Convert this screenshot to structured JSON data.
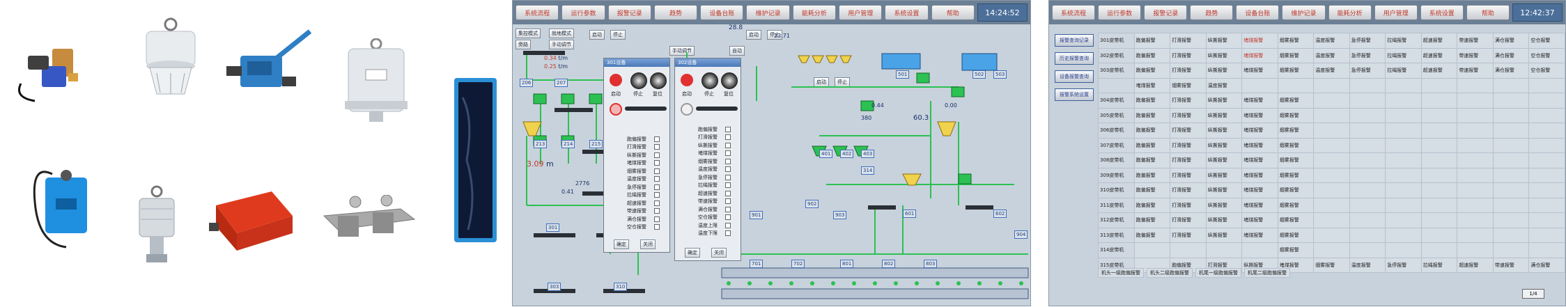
{
  "colors": {
    "scada_bg": "#c8d2dc",
    "tab_text": "#c0392b",
    "pipe_green": "#2cc152",
    "lamp_red": "#e03030",
    "device_blue": "#3a9ad9",
    "device_red": "#d9402a"
  },
  "products": {
    "items": [
      {
        "name": "speed-sensor",
        "icon": "sensor-icon"
      },
      {
        "name": "tear-protector",
        "icon": "bell-sensor-icon"
      },
      {
        "name": "pull-rope-switch",
        "icon": "lever-switch-icon"
      },
      {
        "name": "deviation-switch",
        "icon": "bell-sensor-icon"
      },
      {
        "name": "smoke-sensor-panel",
        "icon": "panel-icon"
      },
      {
        "name": "level-sensor-box",
        "icon": "box-sensor-icon"
      },
      {
        "name": "temperature-sensor",
        "icon": "probe-icon"
      },
      {
        "name": "control-box",
        "icon": "red-box-icon"
      },
      {
        "name": "chute-blocking-switch",
        "icon": "bracket-icon"
      }
    ]
  },
  "scada1": {
    "tabs": [
      "系统流程",
      "运行参数",
      "报警记录",
      "趋势",
      "设备台账",
      "维护记录",
      "能耗分析",
      "用户管理",
      "系统设置",
      "帮助"
    ],
    "clock": "14:24:52",
    "buttons": {
      "mode1": "集控模式",
      "mode2": "就地模式",
      "start": "启动",
      "stop": "停止",
      "manual": "手动调节",
      "auto": "自动",
      "confirm": "确定",
      "close": "关闭",
      "bypass": "旁路"
    },
    "readouts": {
      "flow1": "0.34",
      "flow1_unit": "t/m",
      "flow2": "0.25",
      "flow2_unit": "t/m",
      "level1": "3.09",
      "level1_unit": "m",
      "rate1": "0.41",
      "rate2": "0.44",
      "rate3": "0.00",
      "tank_val": "28.8",
      "tank2_val": "23.71",
      "capacity": "2776",
      "volume": "380",
      "level_pct": "60.3"
    },
    "tags": [
      "206",
      "207",
      "213",
      "214",
      "215",
      "216",
      "301",
      "302",
      "303",
      "310",
      "314",
      "401",
      "402",
      "403",
      "501",
      "502",
      "503",
      "601",
      "602",
      "701",
      "702",
      "801",
      "802",
      "803",
      "901",
      "902",
      "903",
      "904"
    ],
    "dialog1": {
      "title": "301设备",
      "labels": [
        "启动",
        "停止",
        "复位"
      ],
      "alarms": [
        "跑偏报警",
        "打滑报警",
        "纵撕报警",
        "堵煤报警",
        "烟雾报警",
        "温度报警",
        "急停报警",
        "拉绳报警",
        "超速报警",
        "带速报警",
        "满仓报警",
        "空仓报警"
      ],
      "ok": "确定",
      "cancel": "关闭"
    },
    "dialog2": {
      "title": "302设备",
      "labels": [
        "启动",
        "停止",
        "复位"
      ],
      "alarms": [
        "跑偏报警",
        "打滑报警",
        "纵撕报警",
        "堵煤报警",
        "烟雾报警",
        "温度报警",
        "急停报警",
        "拉绳报警",
        "超速报警",
        "带速报警",
        "满仓报警",
        "空仓报警",
        "温度上限",
        "温度下限"
      ],
      "ok": "确定",
      "cancel": "关闭"
    }
  },
  "scada2": {
    "tabs": [
      "系统流程",
      "运行参数",
      "报警记录",
      "趋势",
      "设备台账",
      "维护记录",
      "能耗分析",
      "用户管理",
      "系统设置",
      "帮助"
    ],
    "clock": "12:42:37",
    "side_buttons": [
      "报警查询记录",
      "历史报警查询",
      "设备报警查询",
      "报警系统设置"
    ],
    "rows": [
      [
        "301皮带机",
        "跑偏报警",
        "打滑报警",
        "纵撕报警",
        "堵煤报警",
        "烟雾报警",
        "温度报警",
        "急停报警",
        "拉绳报警",
        "超速报警",
        "带速报警",
        "满仓报警",
        "空仓报警"
      ],
      [
        "302皮带机",
        "跑偏报警",
        "打滑报警",
        "纵撕报警",
        "堵煤报警",
        "烟雾报警",
        "温度报警",
        "急停报警",
        "拉绳报警",
        "超速报警",
        "带速报警",
        "满仓报警",
        "空仓报警"
      ],
      [
        "303皮带机",
        "跑偏报警",
        "打滑报警",
        "纵撕报警",
        "堵煤报警",
        "烟雾报警",
        "温度报警",
        "急停报警",
        "拉绳报警",
        "超速报警",
        "带速报警",
        "满仓报警",
        "空仓报警"
      ],
      [
        "",
        "堵煤报警",
        "烟雾报警",
        "温度报警",
        "",
        "",
        "",
        "",
        "",
        "",
        "",
        "",
        ""
      ],
      [
        "304皮带机",
        "跑偏报警",
        "打滑报警",
        "纵撕报警",
        "堵煤报警",
        "烟雾报警",
        "",
        "",
        "",
        "",
        "",
        "",
        ""
      ],
      [
        "305皮带机",
        "跑偏报警",
        "打滑报警",
        "纵撕报警",
        "堵煤报警",
        "烟雾报警",
        "",
        "",
        "",
        "",
        "",
        "",
        ""
      ],
      [
        "306皮带机",
        "跑偏报警",
        "打滑报警",
        "纵撕报警",
        "堵煤报警",
        "烟雾报警",
        "",
        "",
        "",
        "",
        "",
        "",
        ""
      ],
      [
        "307皮带机",
        "跑偏报警",
        "打滑报警",
        "纵撕报警",
        "堵煤报警",
        "烟雾报警",
        "",
        "",
        "",
        "",
        "",
        "",
        ""
      ],
      [
        "308皮带机",
        "跑偏报警",
        "打滑报警",
        "纵撕报警",
        "堵煤报警",
        "烟雾报警",
        "",
        "",
        "",
        "",
        "",
        "",
        ""
      ],
      [
        "309皮带机",
        "跑偏报警",
        "打滑报警",
        "纵撕报警",
        "堵煤报警",
        "烟雾报警",
        "",
        "",
        "",
        "",
        "",
        "",
        ""
      ],
      [
        "310皮带机",
        "跑偏报警",
        "打滑报警",
        "纵撕报警",
        "堵煤报警",
        "烟雾报警",
        "",
        "",
        "",
        "",
        "",
        "",
        ""
      ],
      [
        "311皮带机",
        "跑偏报警",
        "打滑报警",
        "纵撕报警",
        "堵煤报警",
        "烟雾报警",
        "",
        "",
        "",
        "",
        "",
        "",
        ""
      ],
      [
        "312皮带机",
        "跑偏报警",
        "打滑报警",
        "纵撕报警",
        "堵煤报警",
        "烟雾报警",
        "",
        "",
        "",
        "",
        "",
        "",
        ""
      ],
      [
        "313皮带机",
        "跑偏报警",
        "打滑报警",
        "纵撕报警",
        "堵煤报警",
        "烟雾报警",
        "",
        "",
        "",
        "",
        "",
        "",
        ""
      ],
      [
        "314皮带机",
        "",
        "",
        "",
        "",
        "烟雾报警",
        "",
        "",
        "",
        "",
        "",
        "",
        ""
      ],
      [
        "315皮带机",
        "",
        "跑偏报警",
        "打滑报警",
        "纵撕报警",
        "堵煤报警",
        "烟雾报警",
        "温度报警",
        "急停报警",
        "拉绳报警",
        "超速报警",
        "带速报警",
        "满仓报警"
      ]
    ],
    "bottom": [
      "机头一级跑偏报警",
      "机头二级跑偏报警",
      "机尾一级跑偏报警",
      "机尾二级跑偏报警"
    ],
    "pager": "1/4"
  }
}
